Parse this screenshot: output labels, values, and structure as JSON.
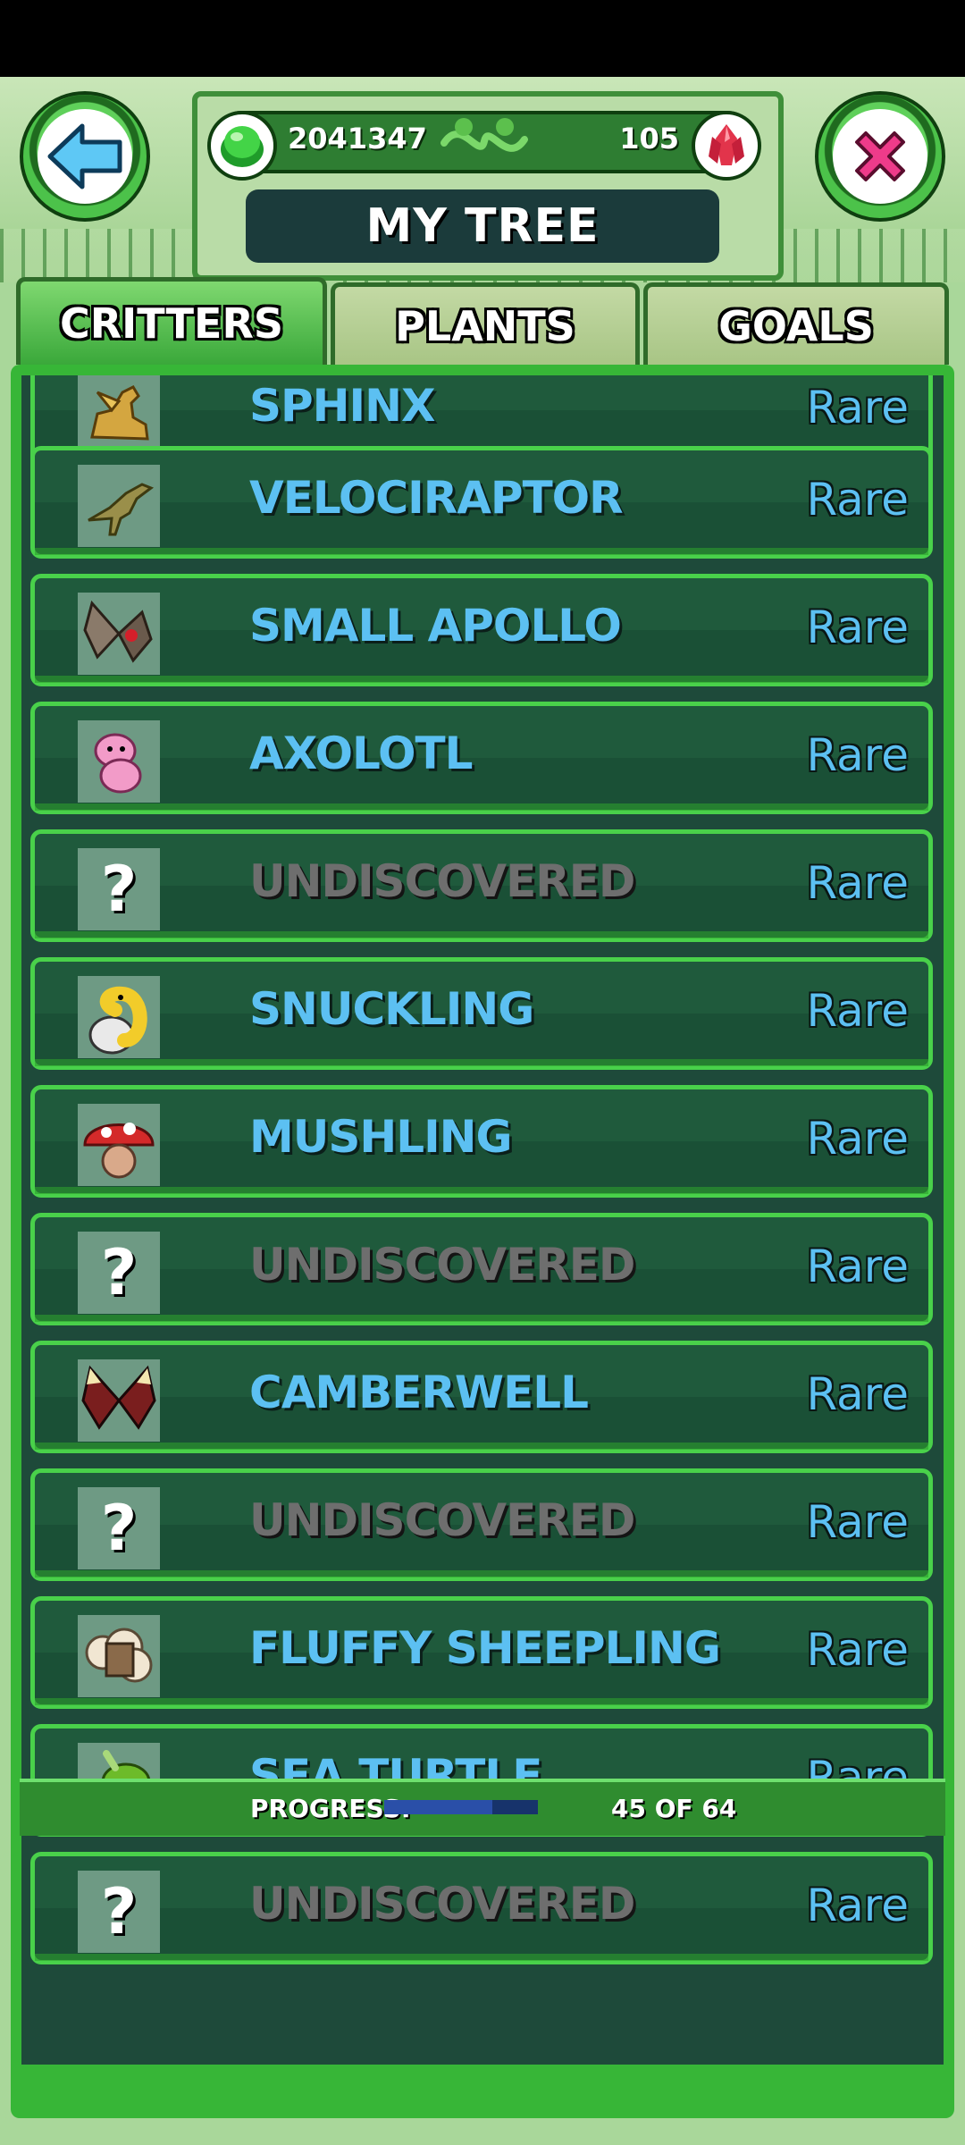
{
  "header": {
    "title": "MY TREE",
    "green_currency": "2041347",
    "red_currency": "105"
  },
  "tabs": [
    {
      "label": "CRITTERS",
      "active": true
    },
    {
      "label": "PLANTS",
      "active": false
    },
    {
      "label": "GOALS",
      "active": false
    }
  ],
  "critters": [
    {
      "name": "SPHINX",
      "rarity": "Rare",
      "discovered": true,
      "icon": "sphinx-icon"
    },
    {
      "name": "VELOCIRAPTOR",
      "rarity": "Rare",
      "discovered": true,
      "icon": "velociraptor-icon"
    },
    {
      "name": "SMALL APOLLO",
      "rarity": "Rare",
      "discovered": true,
      "icon": "butterfly-icon"
    },
    {
      "name": "AXOLOTL",
      "rarity": "Rare",
      "discovered": true,
      "icon": "axolotl-icon"
    },
    {
      "name": "UNDISCOVERED",
      "rarity": "Rare",
      "discovered": false,
      "icon": "question-mark-icon"
    },
    {
      "name": "SNUCKLING",
      "rarity": "Rare",
      "discovered": true,
      "icon": "snake-icon"
    },
    {
      "name": "MUSHLING",
      "rarity": "Rare",
      "discovered": true,
      "icon": "mushroom-icon"
    },
    {
      "name": "UNDISCOVERED",
      "rarity": "Rare",
      "discovered": false,
      "icon": "question-mark-icon"
    },
    {
      "name": "CAMBERWELL",
      "rarity": "Rare",
      "discovered": true,
      "icon": "moth-icon"
    },
    {
      "name": "UNDISCOVERED",
      "rarity": "Rare",
      "discovered": false,
      "icon": "question-mark-icon"
    },
    {
      "name": "FLUFFY SHEEPLING",
      "rarity": "Rare",
      "discovered": true,
      "icon": "sheep-icon"
    },
    {
      "name": "SEA TURTLE",
      "rarity": "Rare",
      "discovered": true,
      "icon": "turtle-icon"
    },
    {
      "name": "UNDISCOVERED",
      "rarity": "Rare",
      "discovered": false,
      "icon": "question-mark-icon"
    }
  ],
  "progress": {
    "label": "PROGRESS:",
    "count_text": "45 OF 64",
    "fraction": 0.703
  },
  "colors": {
    "accent_green": "#37b637",
    "name_blue": "#5cc0f2",
    "unknown_gray": "#6e6e6e"
  }
}
